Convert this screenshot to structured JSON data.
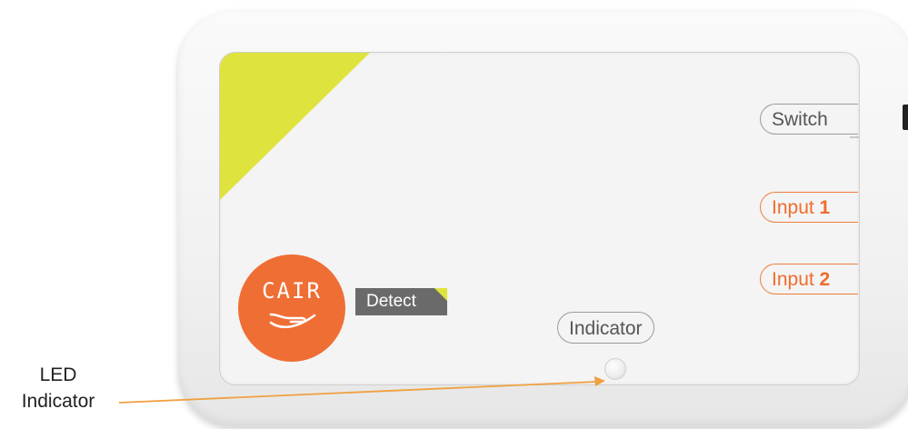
{
  "device": {
    "labels": {
      "switch": "Switch",
      "input1_prefix": "Input ",
      "input1_number": "1",
      "input2_prefix": "Input ",
      "input2_number": "2",
      "indicator": "Indicator"
    },
    "logo": {
      "brand": "CAIR",
      "product": "Detect"
    }
  },
  "annotation": {
    "line1": "LED",
    "line2": "Indicator"
  },
  "colors": {
    "accent_orange": "#ef6e34",
    "accent_yellow": "#dfe33d",
    "tag_gray": "#6a6a6a"
  }
}
